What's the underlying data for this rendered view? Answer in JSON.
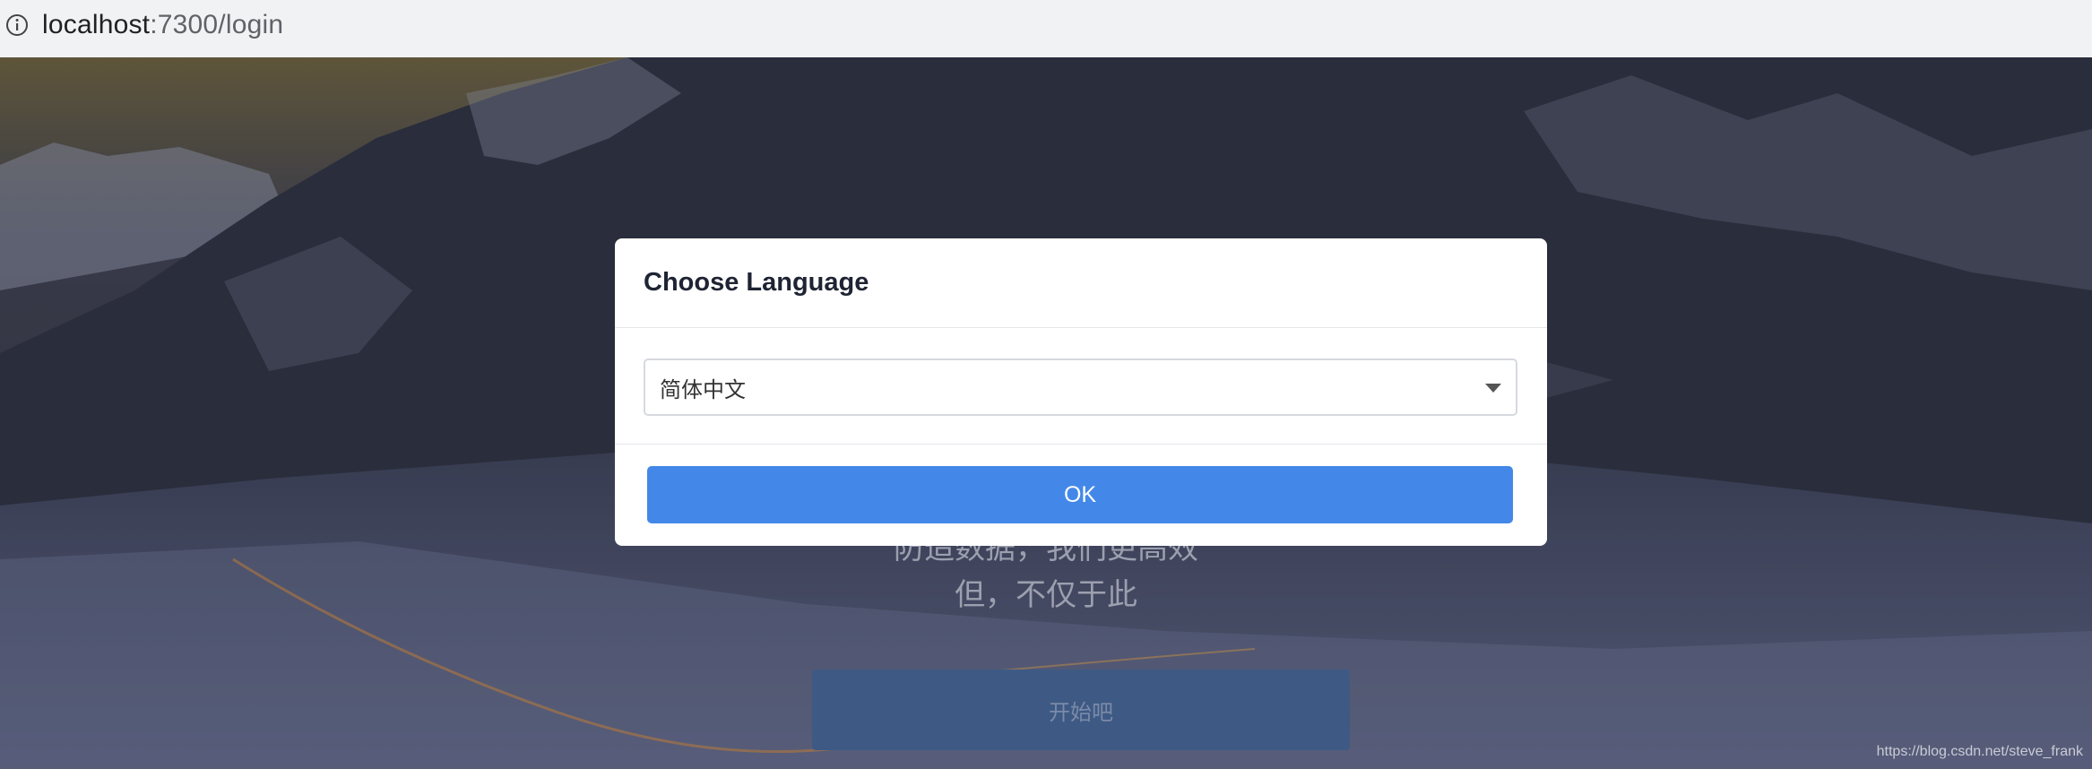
{
  "browser": {
    "host": "localhost",
    "path": ":7300/login"
  },
  "page": {
    "slogan_line1": "防造数据，我们更高效",
    "slogan_line2": "但，不仅于此",
    "start_label": "开始吧",
    "credit": "https://blog.csdn.net/steve_frank"
  },
  "modal": {
    "title": "Choose Language",
    "language_select": {
      "selected": "简体中文"
    },
    "ok_label": "OK"
  },
  "colors": {
    "accent": "#4388e8",
    "start_button": "#3e5a84"
  },
  "icons": {
    "address_info": "info-icon",
    "select_caret": "caret-down-icon"
  }
}
